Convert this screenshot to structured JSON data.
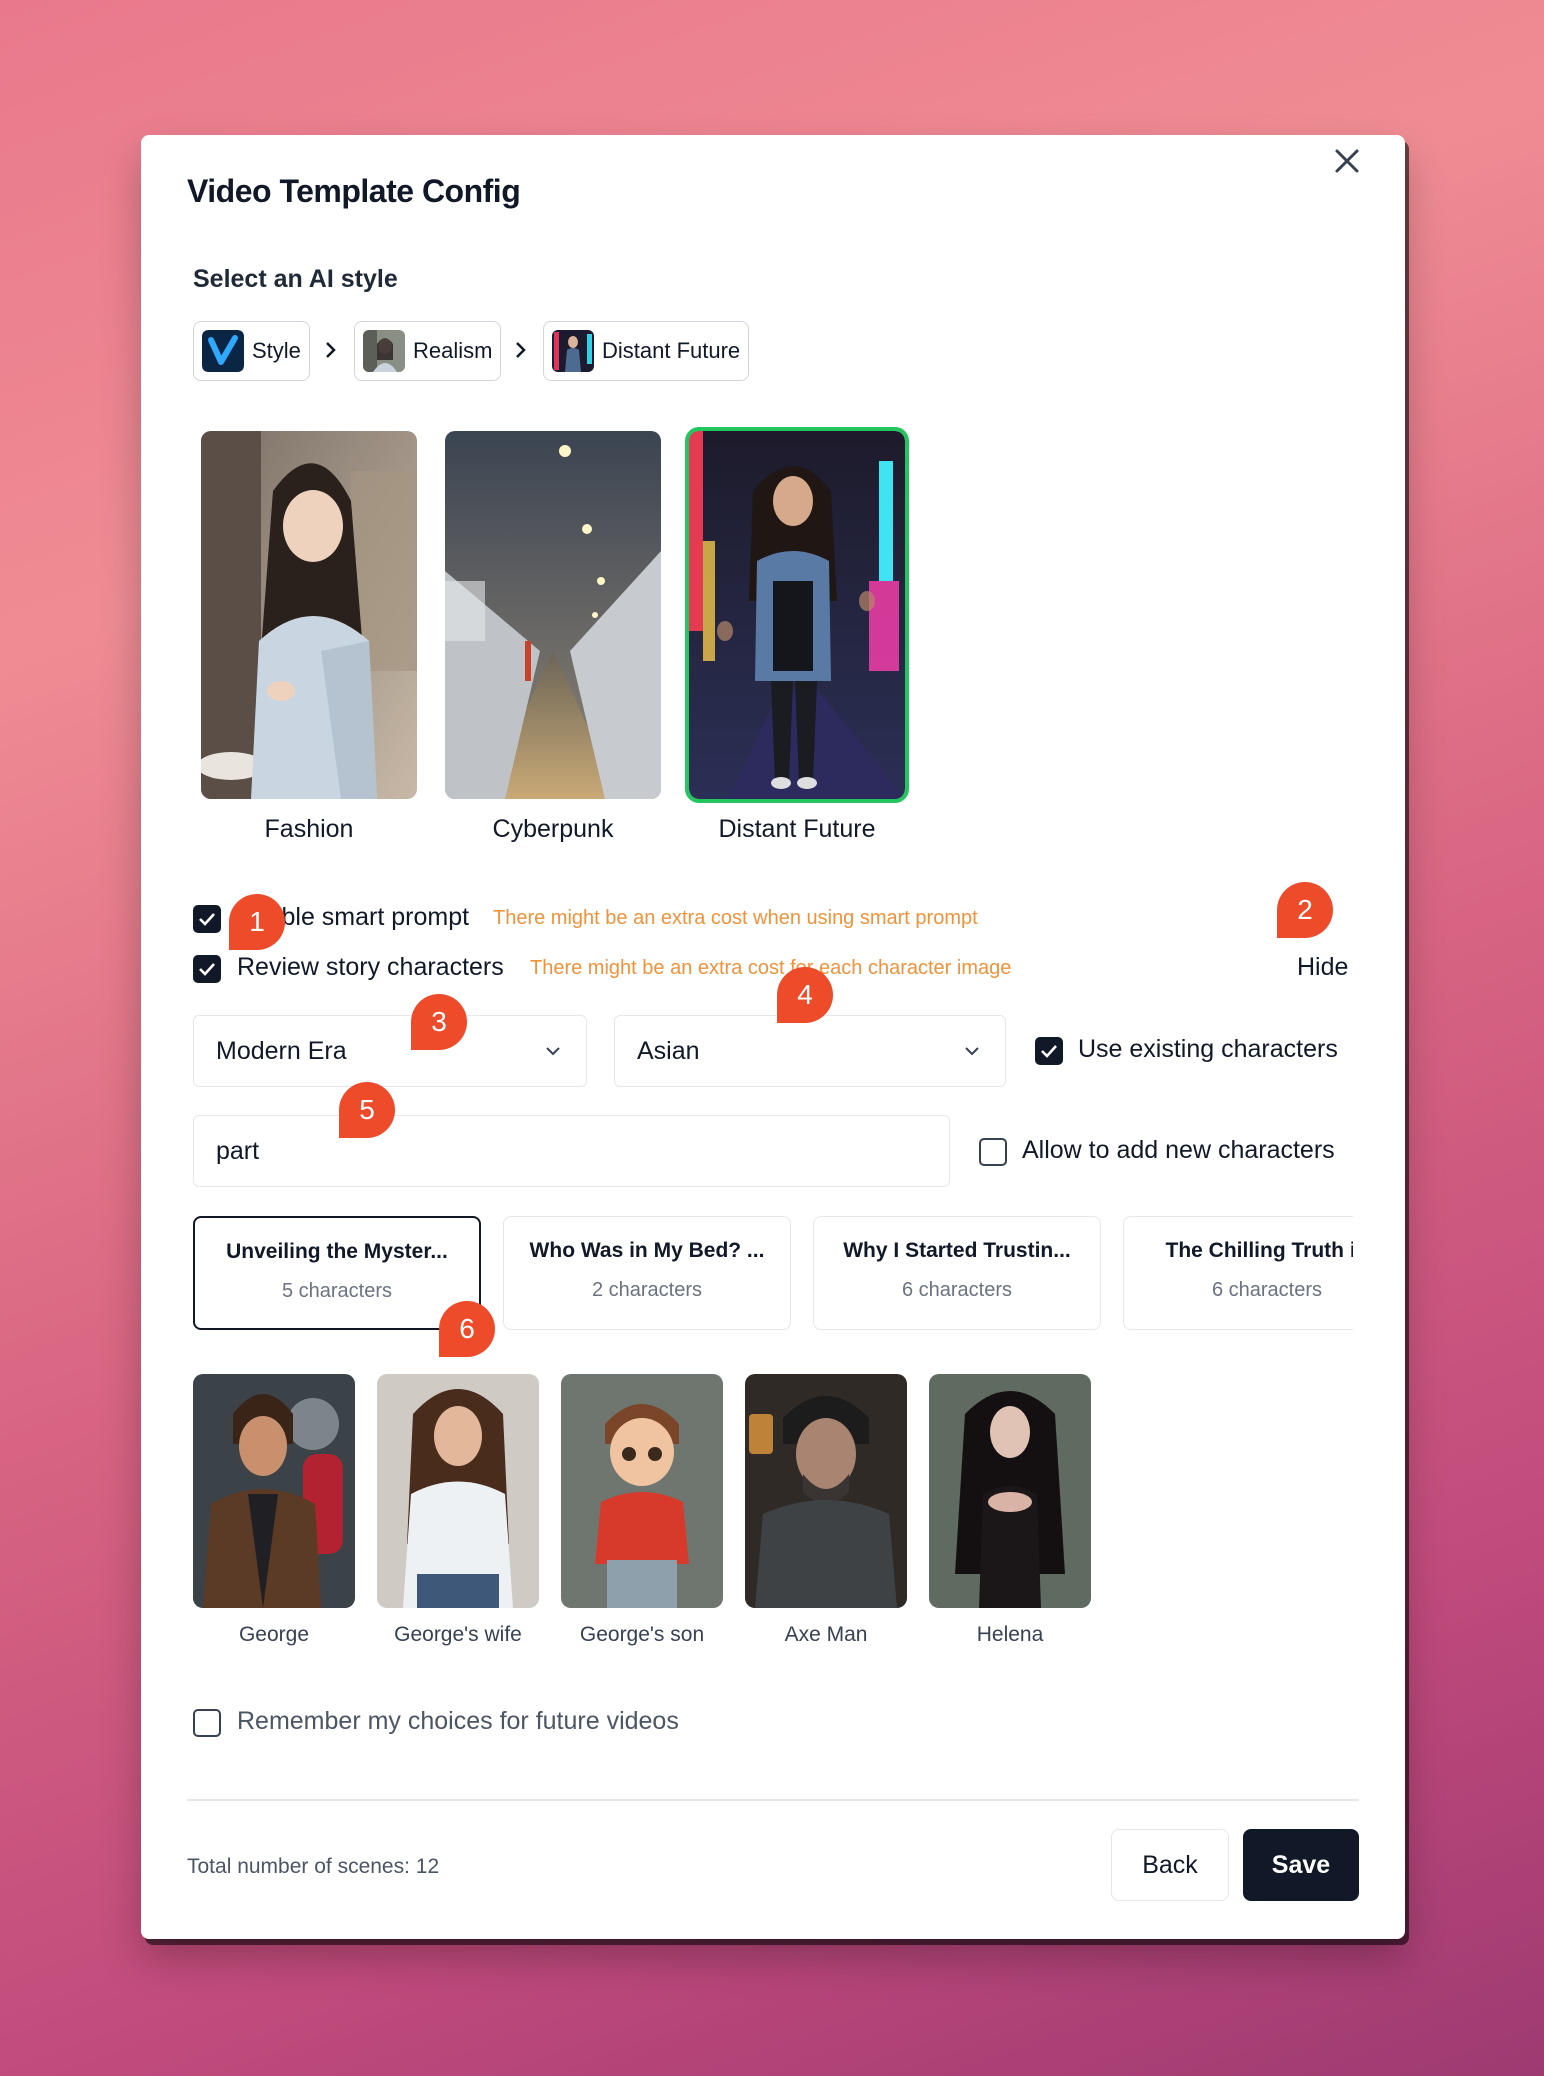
{
  "dialog": {
    "title": "Video Template Config",
    "close_icon": "close-icon"
  },
  "style_section": {
    "label": "Select an AI style",
    "breadcrumb": [
      {
        "label": "Style"
      },
      {
        "label": "Realism"
      },
      {
        "label": "Distant Future"
      }
    ],
    "options": [
      {
        "label": "Fashion",
        "selected": false
      },
      {
        "label": "Cyberpunk",
        "selected": false
      },
      {
        "label": "Distant Future",
        "selected": true
      }
    ]
  },
  "options": {
    "smart_prompt": {
      "label": "Enable smart prompt",
      "checked": true,
      "warning": "There might be an extra cost when using smart prompt"
    },
    "review_characters": {
      "label": "Review story characters",
      "checked": true,
      "warning": "There might be an extra cost for each character image"
    },
    "hide_link": "Hide"
  },
  "filters": {
    "era": "Modern Era",
    "ethnicity": "Asian",
    "use_existing": {
      "label": "Use existing characters",
      "checked": true
    },
    "search_value": "part",
    "allow_new": {
      "label": "Allow to add new characters",
      "checked": false
    }
  },
  "stories": [
    {
      "title": "Unveiling the Myster...",
      "count": "5 characters",
      "active": true
    },
    {
      "title": "Who Was in My Bed? ...",
      "count": "2 characters",
      "active": false
    },
    {
      "title": "Why I Started Trustin...",
      "count": "6 characters",
      "active": false
    },
    {
      "title": "The Chilling Truth in",
      "count": "6 characters",
      "active": false
    }
  ],
  "characters": [
    {
      "name": "George"
    },
    {
      "name": "George's wife"
    },
    {
      "name": "George's son"
    },
    {
      "name": "Axe Man"
    },
    {
      "name": "Helena"
    }
  ],
  "remember": {
    "label": "Remember my choices for future videos",
    "checked": false
  },
  "footer": {
    "total_scenes": "Total number of scenes: 12",
    "back_label": "Back",
    "save_label": "Save"
  },
  "badges": [
    "1",
    "2",
    "3",
    "4",
    "5",
    "6"
  ],
  "colors": {
    "accent_dark": "#111827",
    "selected_border": "#22c55e",
    "warning_text": "#f0923a",
    "badge": "#ee4b2b"
  }
}
